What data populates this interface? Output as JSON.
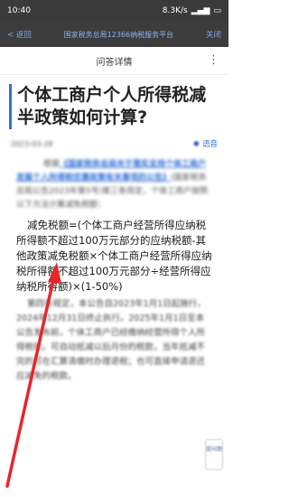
{
  "status": {
    "time": "10:40",
    "network": "8.3K/s"
  },
  "nav": {
    "back": "< 返回",
    "title": "国家税务总局12366纳税服务平台",
    "close": "关闭"
  },
  "header": {
    "title": "问答详情"
  },
  "article": {
    "title": "个体工商户个人所得税减半政策如何计算?",
    "date": "2023-03-28",
    "listen": "语音",
    "intro_prefix": "根据",
    "intro_link": "《国家税务总局关于落实支持个体工商户发展个人所得税优惠政策有关事项的公告》",
    "intro_rest": "(国家税务总局公告2023年第5号)第三条规定，个体工商户按照以下方法计算减免税额：",
    "formula": "减免税额=(个体工商户经营所得应纳税所得额不超过100万元部分的应纳税额-其他政策减免税额×个体工商户经营所得应纳税所得额不超过100万元部分÷经营所得应纳税所得额)×(1-50%)",
    "rest": "第四条规定，本公告自2023年1月1日起施行，2024年12月31日终止执行。2025年1月1日至本公告发布前，个体工商户已经缴纳经营所得个人所得税的，可自动抵减以后月份的税款，当年抵减不完的可在汇算清缴时办理退税；也可直接申请退还应减免的税款。"
  },
  "side_button": "提问题"
}
